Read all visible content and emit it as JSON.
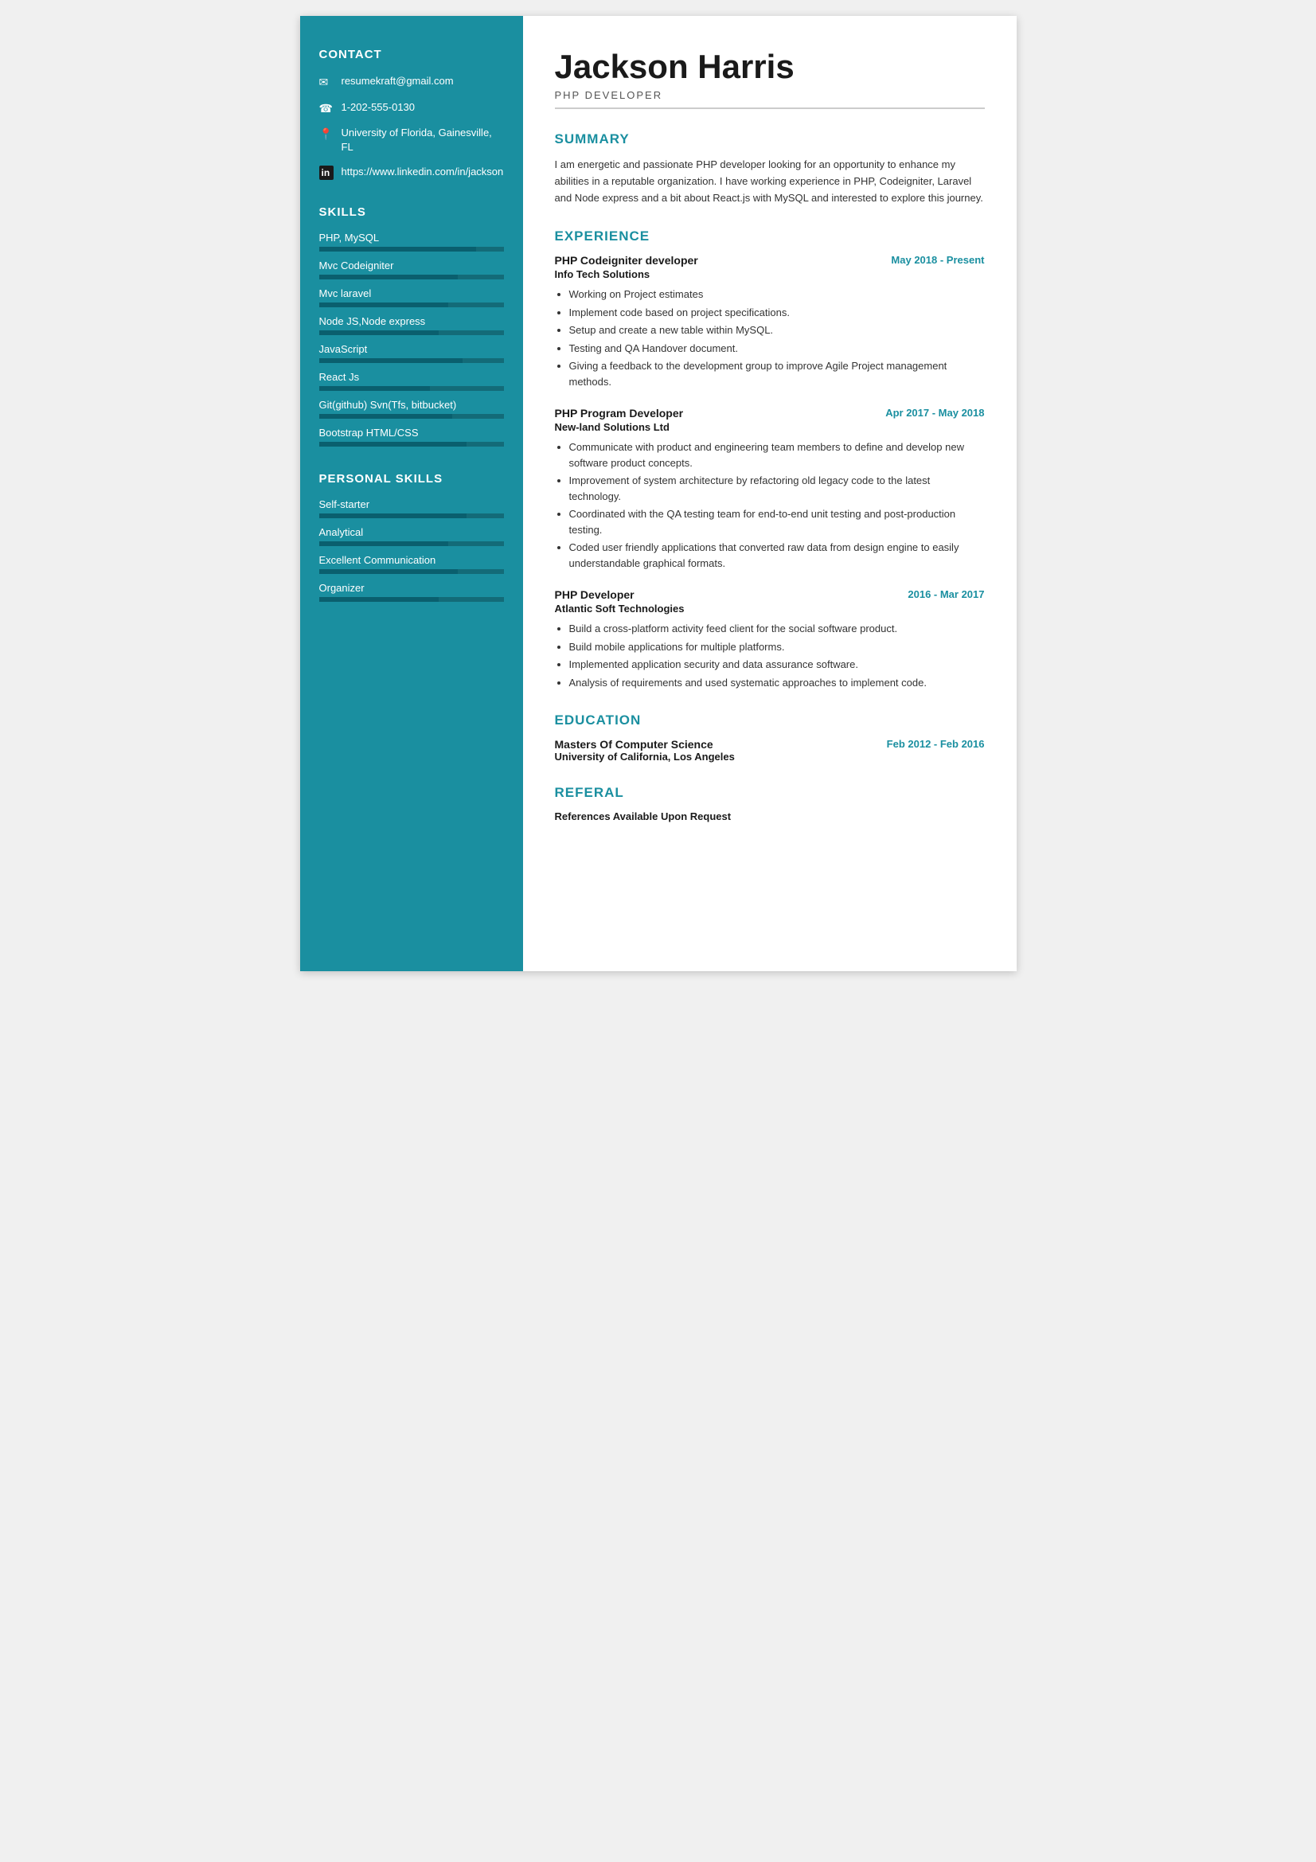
{
  "sidebar": {
    "contact_title": "CONTACT",
    "contact_items": [
      {
        "icon": "✉",
        "text": "resumekraft@gmail.com"
      },
      {
        "icon": "📞",
        "text": "1-202-555-0130"
      },
      {
        "icon": "📍",
        "text": "University of Florida, Gainesville, FL"
      },
      {
        "icon": "in",
        "text": "https://www.linkedin.com/in/jackson"
      }
    ],
    "skills_title": "SKILLS",
    "skills": [
      {
        "label": "PHP, MySQL",
        "pct": 85
      },
      {
        "label": "Mvc Codeigniter",
        "pct": 75
      },
      {
        "label": "Mvc laravel",
        "pct": 70
      },
      {
        "label": "Node JS,Node express",
        "pct": 65
      },
      {
        "label": "JavaScript",
        "pct": 78
      },
      {
        "label": "React Js",
        "pct": 60
      },
      {
        "label": "Git(github) Svn(Tfs, bitbucket)",
        "pct": 72
      },
      {
        "label": "Bootstrap HTML/CSS",
        "pct": 80
      }
    ],
    "personal_skills_title": "PERSONAL SKILLS",
    "personal_skills": [
      {
        "label": "Self-starter",
        "pct": 80
      },
      {
        "label": "Analytical",
        "pct": 70
      },
      {
        "label": "Excellent Communication",
        "pct": 75
      },
      {
        "label": "Organizer",
        "pct": 65
      }
    ]
  },
  "main": {
    "name": "Jackson Harris",
    "job_title": "PHP DEVELOPER",
    "summary_title": "SUMMARY",
    "summary_text": "I am energetic and passionate PHP developer looking for an opportunity to enhance my abilities in a reputable organization. I have working experience in PHP, Codeigniter, Laravel and Node express and a bit about React.js with MySQL and interested to explore this journey.",
    "experience_title": "EXPERIENCE",
    "experiences": [
      {
        "role": "PHP Codeigniter developer",
        "date": "May 2018 - Present",
        "company": "Info Tech Solutions",
        "bullets": [
          "Working on Project estimates",
          "Implement code based on project specifications.",
          "Setup and create a new table within MySQL.",
          "Testing and QA Handover document.",
          "Giving a feedback to the development group to improve Agile Project management methods."
        ]
      },
      {
        "role": "PHP Program Developer",
        "date": "Apr 2017 - May 2018",
        "company": "New-land Solutions Ltd",
        "bullets": [
          "Communicate with product and engineering team members to define and develop new software product concepts.",
          "Improvement of system architecture by refactoring old legacy code to the latest technology.",
          "Coordinated with the QA testing team for end-to-end unit testing and post-production testing.",
          "Coded user friendly applications that converted raw data from design engine to easily understandable graphical formats."
        ]
      },
      {
        "role": "PHP Developer",
        "date": "2016 - Mar 2017",
        "company": "Atlantic Soft Technologies",
        "bullets": [
          "Build a cross-platform activity feed client for the social software product.",
          "Build mobile applications for multiple platforms.",
          "Implemented application security and data assurance software.",
          "Analysis of requirements and used systematic approaches to implement code."
        ]
      }
    ],
    "education_title": "EDUCATION",
    "education": [
      {
        "degree": "Masters Of Computer Science",
        "school": "University of California, Los Angeles",
        "date": "Feb 2012 - Feb 2016"
      }
    ],
    "referal_title": "REFERAL",
    "referal_text": "References Available Upon Request"
  }
}
